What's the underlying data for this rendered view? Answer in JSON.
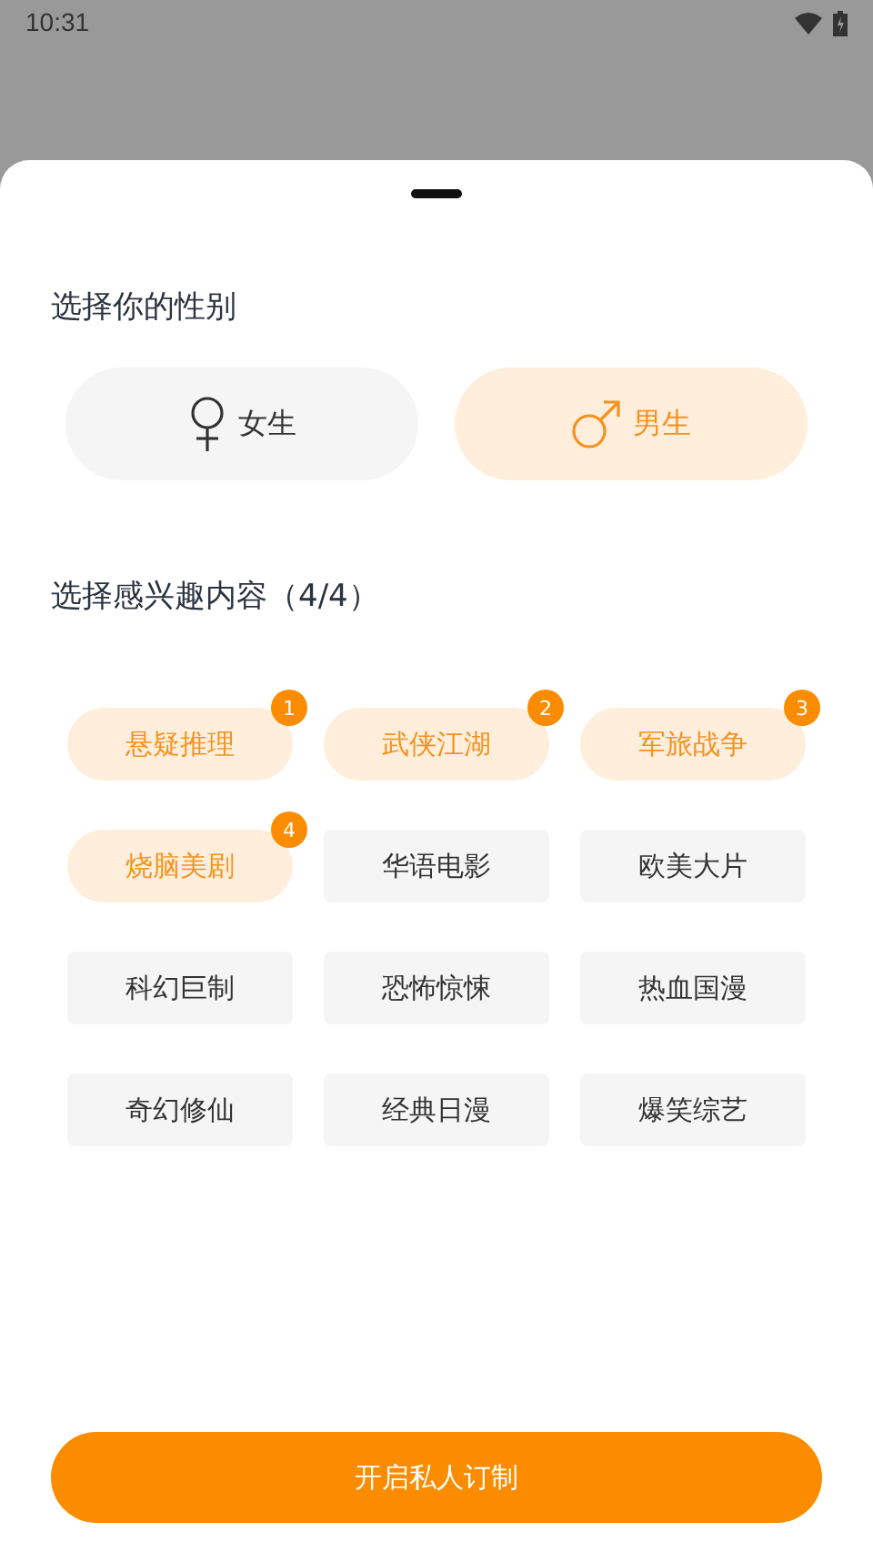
{
  "status_bar": {
    "time": "10:31"
  },
  "gender": {
    "title": "选择你的性别",
    "options": [
      {
        "label": "女生",
        "kind": "female",
        "selected": false
      },
      {
        "label": "男生",
        "kind": "male",
        "selected": true
      }
    ]
  },
  "interests": {
    "title": "选择感兴趣内容（4/4）",
    "items": [
      {
        "label": "悬疑推理",
        "selected": true,
        "badge": "1"
      },
      {
        "label": "武侠江湖",
        "selected": true,
        "badge": "2"
      },
      {
        "label": "军旅战争",
        "selected": true,
        "badge": "3"
      },
      {
        "label": "烧脑美剧",
        "selected": true,
        "badge": "4"
      },
      {
        "label": "华语电影",
        "selected": false
      },
      {
        "label": "欧美大片",
        "selected": false
      },
      {
        "label": "科幻巨制",
        "selected": false
      },
      {
        "label": "恐怖惊悚",
        "selected": false
      },
      {
        "label": "热血国漫",
        "selected": false
      },
      {
        "label": "奇幻修仙",
        "selected": false
      },
      {
        "label": "经典日漫",
        "selected": false
      },
      {
        "label": "爆笑综艺",
        "selected": false
      }
    ]
  },
  "submit": {
    "label": "开启私人订制"
  }
}
